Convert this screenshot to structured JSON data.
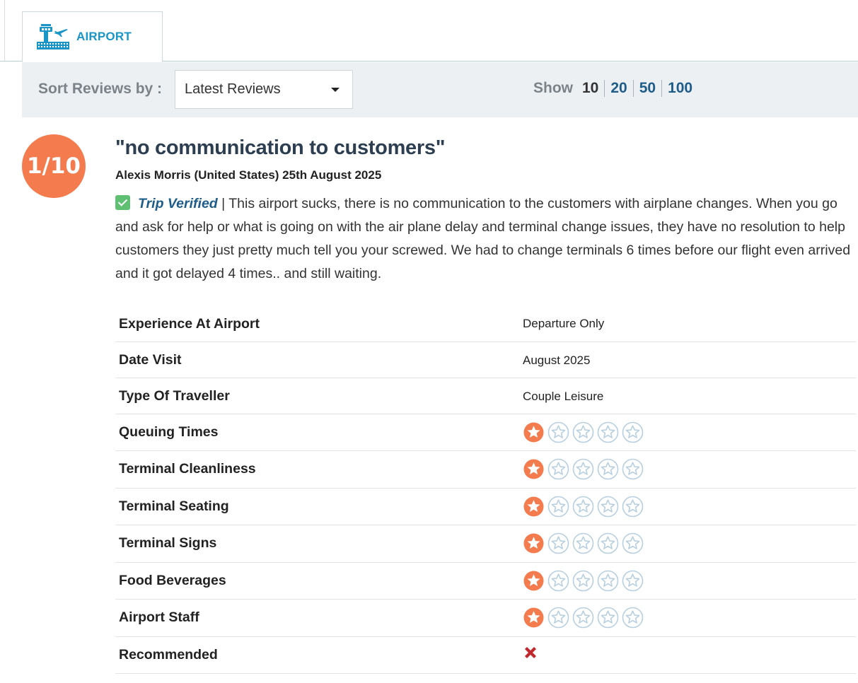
{
  "tab": {
    "label": "AIRPORT",
    "icon": "airport-icon"
  },
  "sort": {
    "label": "Sort Reviews by :",
    "selected": "Latest Reviews",
    "icon": "chevron-down-icon"
  },
  "show": {
    "label": "Show",
    "options": [
      "10",
      "20",
      "50",
      "100"
    ],
    "current": "10"
  },
  "review": {
    "rating": "1/10",
    "title": "\"no communication to customers\"",
    "author_line": "Alexis Morris (United States) 25th August 2025",
    "verified_label": "Trip Verified",
    "separator": " | ",
    "body": "This airport sucks, there is no communication to the customers with airplane changes. When you go and ask for help or what is going on with the air plane delay and terminal change issues, they have no resolution to help customers they just pretty much tell you your screwed. We had to change terminals 6 times before our flight even arrived and it got delayed 4 times.. and still waiting.",
    "details": [
      {
        "label": "Experience At Airport",
        "value": "Departure Only"
      },
      {
        "label": "Date Visit",
        "value": "August 2025"
      },
      {
        "label": "Type Of Traveller",
        "value": "Couple Leisure"
      }
    ],
    "star_ratings": [
      {
        "label": "Queuing Times",
        "stars": 1,
        "max": 5
      },
      {
        "label": "Terminal Cleanliness",
        "stars": 1,
        "max": 5
      },
      {
        "label": "Terminal Seating",
        "stars": 1,
        "max": 5
      },
      {
        "label": "Terminal Signs",
        "stars": 1,
        "max": 5
      },
      {
        "label": "Food Beverages",
        "stars": 1,
        "max": 5
      },
      {
        "label": "Airport Staff",
        "stars": 1,
        "max": 5
      }
    ],
    "recommended": {
      "label": "Recommended",
      "value": "no",
      "icon": "cross-icon"
    }
  },
  "colors": {
    "accent": "#1996c7",
    "rating_badge": "#f47b4d",
    "star_filled": "#f47b4d",
    "star_empty": "#b8cfdf",
    "not_recommended": "#c0282d",
    "link": "#1e5d8a"
  }
}
